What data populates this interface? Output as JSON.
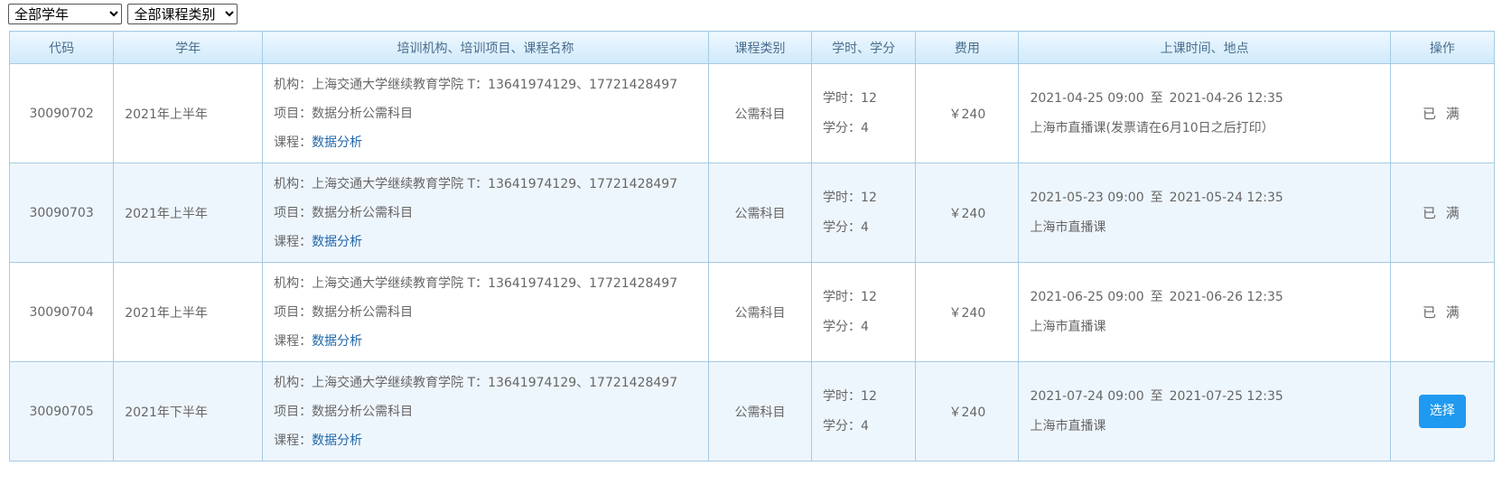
{
  "filters": {
    "year": {
      "selected": "全部学年"
    },
    "category": {
      "selected": "全部课程类别"
    }
  },
  "table": {
    "headers": {
      "code": "代码",
      "year": "学年",
      "course": "培训机构、培训项目、课程名称",
      "category": "课程类别",
      "hours_credits": "学时、学分",
      "fee": "费用",
      "time_place": "上课时间、地点",
      "action": "操作"
    },
    "rows": [
      {
        "code": "30090702",
        "year": "2021年上半年",
        "institution": "机构：上海交通大学继续教育学院 T：13641974129、17721428497",
        "project": "项目：数据分析公需科目",
        "course_prefix": "课程：",
        "course_name": "数据分析",
        "category": "公需科目",
        "hours": "学时：12",
        "credits": "学分：4",
        "fee": "￥240",
        "start": "2021-04-25 09:00",
        "to": "至",
        "end": "2021-04-26 12:35",
        "place": "上海市直播课(发票请在6月10日之后打印）",
        "action": "已 满"
      },
      {
        "code": "30090703",
        "year": "2021年上半年",
        "institution": "机构：上海交通大学继续教育学院 T：13641974129、17721428497",
        "project": "项目：数据分析公需科目",
        "course_prefix": "课程：",
        "course_name": "数据分析",
        "category": "公需科目",
        "hours": "学时：12",
        "credits": "学分：4",
        "fee": "￥240",
        "start": "2021-05-23 09:00",
        "to": "至",
        "end": "2021-05-24 12:35",
        "place": "上海市直播课",
        "action": "已 满"
      },
      {
        "code": "30090704",
        "year": "2021年上半年",
        "institution": "机构：上海交通大学继续教育学院 T：13641974129、17721428497",
        "project": "项目：数据分析公需科目",
        "course_prefix": "课程：",
        "course_name": "数据分析",
        "category": "公需科目",
        "hours": "学时：12",
        "credits": "学分：4",
        "fee": "￥240",
        "start": "2021-06-25 09:00",
        "to": "至",
        "end": "2021-06-26 12:35",
        "place": "上海市直播课",
        "action": "已 满"
      },
      {
        "code": "30090705",
        "year": "2021年下半年",
        "institution": "机构：上海交通大学继续教育学院 T：13641974129、17721428497",
        "project": "项目：数据分析公需科目",
        "course_prefix": "课程：",
        "course_name": "数据分析",
        "category": "公需科目",
        "hours": "学时：12",
        "credits": "学分：4",
        "fee": "￥240",
        "start": "2021-07-24 09:00",
        "to": "至",
        "end": "2021-07-25 12:35",
        "place": "上海市直播课",
        "action_button": "选择"
      }
    ]
  },
  "colors": {
    "header_gradient_top": "#eef8ff",
    "header_gradient_bottom": "#cfe9fb",
    "border": "#a6cbe3",
    "alt_row": "#eef6fd",
    "link": "#2167a8",
    "button": "#1f9af0"
  }
}
